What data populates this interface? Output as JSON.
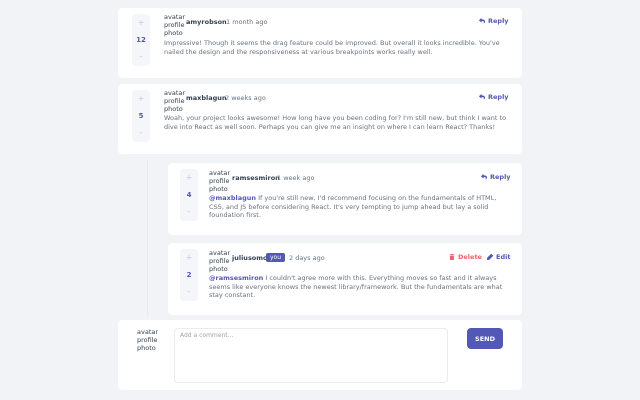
{
  "accent": "#5357b6",
  "danger": "#ed6368",
  "comments": [
    {
      "username": "amyrobson",
      "avatar_alt": "avatar profile photo",
      "time": "1 month ago",
      "score": "12",
      "upvote_glyph": "+",
      "downvote_glyph": "–",
      "reply_label": "Reply",
      "content": "Impressive! Though it seems the drag feature could be improved. But overall it looks incredible. You've nailed the design and the responsiveness at various breakpoints works really well."
    },
    {
      "username": "maxblagun",
      "avatar_alt": "avatar profile photo",
      "time": "2 weeks ago",
      "score": "5",
      "upvote_glyph": "+",
      "downvote_glyph": "–",
      "reply_label": "Reply",
      "content": "Woah, your project looks awesome! How long have you been coding for? I'm still new, but think I want to dive into React as well soon. Perhaps you can give me an insight on where I can learn React? Thanks!"
    }
  ],
  "replies": [
    {
      "username": "ramsesmiron",
      "avatar_alt": "avatar profile photo",
      "time": "1 week ago",
      "score": "4",
      "upvote_glyph": "+",
      "downvote_glyph": "–",
      "reply_label": "Reply",
      "mention": "@maxblagun",
      "content": " If you're still new, I'd recommend focusing on the fundamentals of HTML, CSS, and JS before considering React. It's very tempting to jump ahead but lay a solid foundation first."
    },
    {
      "username": "juliusomo",
      "avatar_alt": "avatar profile photo",
      "you_badge": "you",
      "time": "2 days ago",
      "score": "2",
      "upvote_glyph": "+",
      "downvote_glyph": "–",
      "delete_label": "Delete",
      "edit_label": "Edit",
      "mention": "@ramsesmiron",
      "content": " I couldn't agree more with this. Everything moves so fast and it always seems like everyone knows the newest library/framework. But the fundamentals are what stay constant."
    }
  ],
  "composer": {
    "avatar_alt": "avatar profile photo",
    "placeholder": "Add a comment...",
    "value": "",
    "send_label": "SEND"
  },
  "icons": {
    "reply": "reply-icon",
    "delete": "trash-icon",
    "edit": "pencil-icon"
  }
}
